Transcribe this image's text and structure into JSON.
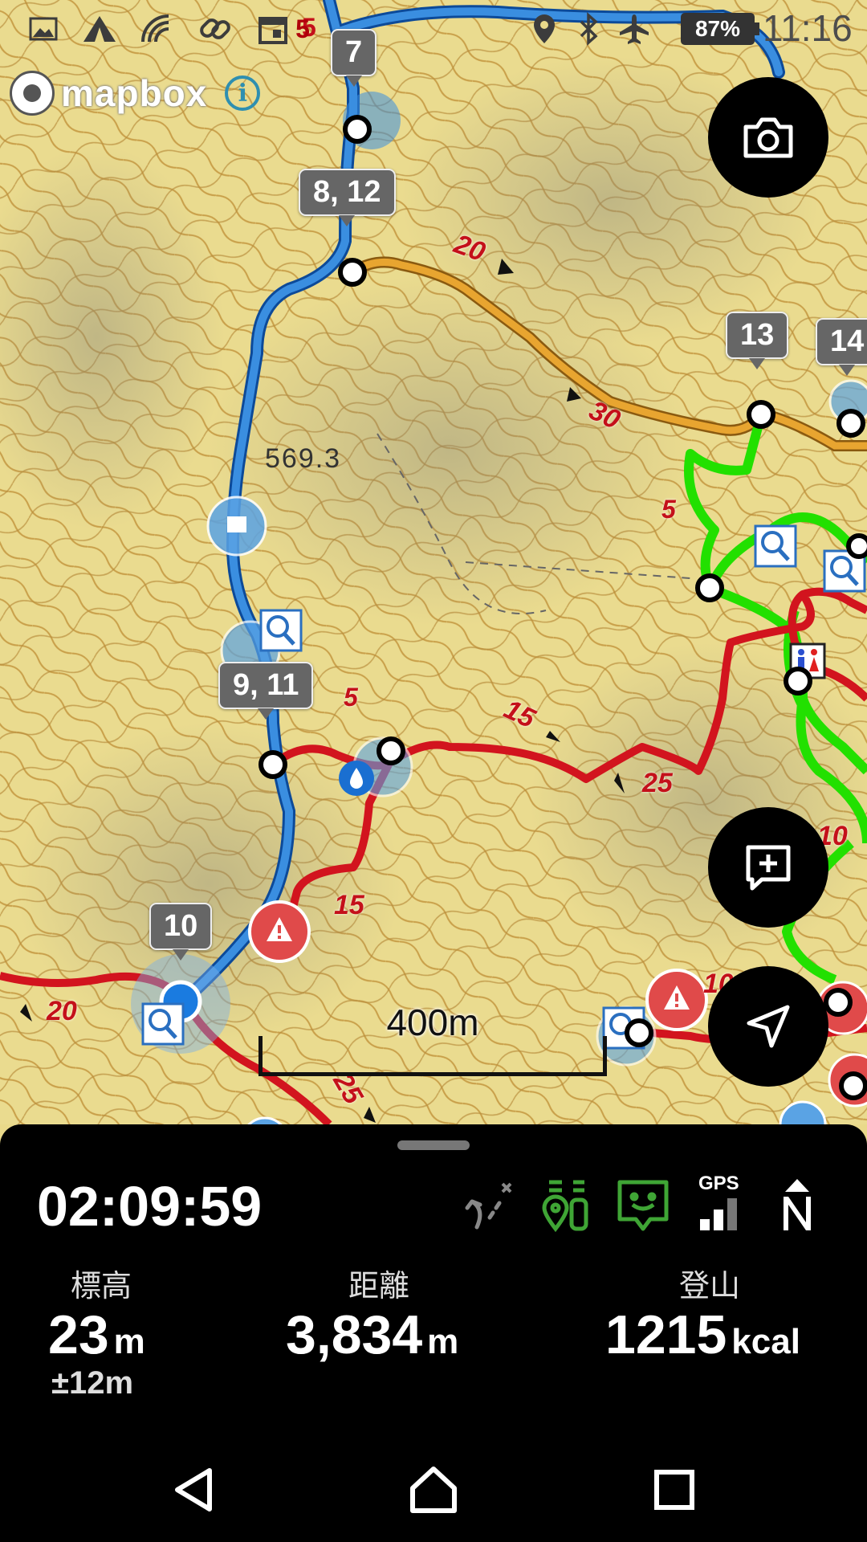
{
  "status_bar": {
    "calendar_badge": "5",
    "battery": "87%",
    "time": "11:16"
  },
  "map": {
    "attribution": "mapbox",
    "info_glyph": "i",
    "spot_height": "569.3",
    "scale_label": "400m",
    "waypoints": [
      "7",
      "8, 12",
      "13",
      "14",
      "9, 11",
      "10"
    ],
    "segment_times": [
      "5",
      "20",
      "30",
      "5",
      "5",
      "15",
      "25",
      "15",
      "20",
      "10",
      "10",
      "25"
    ]
  },
  "panel": {
    "elapsed": "02:09:59",
    "gps_label": "GPS",
    "compass_letter": "N",
    "altitude": {
      "label": "標高",
      "value": "23",
      "unit": "m",
      "accuracy": "±12m"
    },
    "distance": {
      "label": "距離",
      "value": "3,834",
      "unit": "m"
    },
    "calories": {
      "label": "登山",
      "value": "1215",
      "unit": "kcal"
    }
  },
  "colors": {
    "track_blue": "#3a8ee0",
    "route_orange": "#e8a530",
    "route_red": "#d2141e",
    "route_green": "#22e000",
    "panel_green": "#3fa535"
  },
  "icons": [
    "gallery-icon",
    "tent-icon",
    "signal-icon",
    "link-icon",
    "calendar-icon",
    "location-pin-icon",
    "bluetooth-icon",
    "airplane-icon",
    "camera-icon",
    "add-note-icon",
    "navigation-arrow-icon",
    "route-off-icon",
    "companions-icon",
    "chat-face-icon",
    "gps-signal-icon",
    "north-compass-icon",
    "back-icon",
    "home-icon",
    "recents-icon"
  ]
}
